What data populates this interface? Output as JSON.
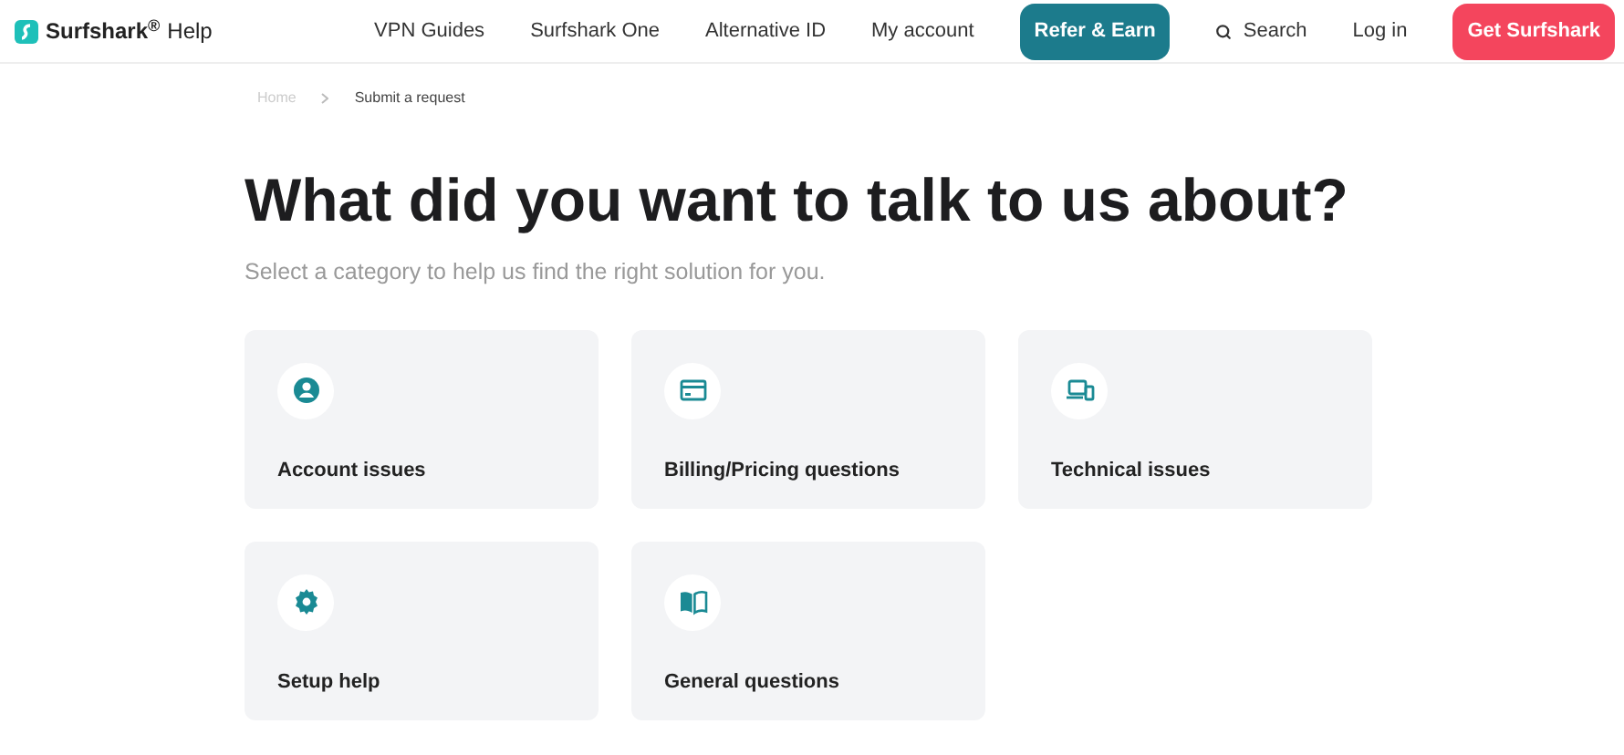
{
  "header": {
    "brand": "Surfshark$^{®}$",
    "brand_suffix": "Help",
    "nav": [
      {
        "kind": "link",
        "label": "VPN Guides"
      },
      {
        "kind": "link",
        "label": "Surfshark One"
      },
      {
        "kind": "link",
        "label": "Alternative ID"
      },
      {
        "kind": "link",
        "label": "My account"
      },
      {
        "kind": "accent",
        "label": "Refer & Earn"
      },
      {
        "kind": "search",
        "label": "Search"
      },
      {
        "kind": "link",
        "label": "Log in"
      },
      {
        "kind": "primary",
        "label": "Get Surfshark"
      }
    ]
  },
  "breadcrumb": [
    "Home",
    "Submit a request"
  ],
  "title": "What did you want to talk to us about?",
  "subtitle": "Select a category to help us find the right solution for you.",
  "categories": [
    {
      "kind": "account",
      "label": "Account issues"
    },
    {
      "kind": "billing",
      "label": "Billing/Pricing questions"
    },
    {
      "kind": "technical",
      "label": "Technical issues"
    },
    {
      "kind": "setup",
      "label": "Setup help"
    },
    {
      "kind": "general",
      "label": "General questions"
    }
  ]
}
